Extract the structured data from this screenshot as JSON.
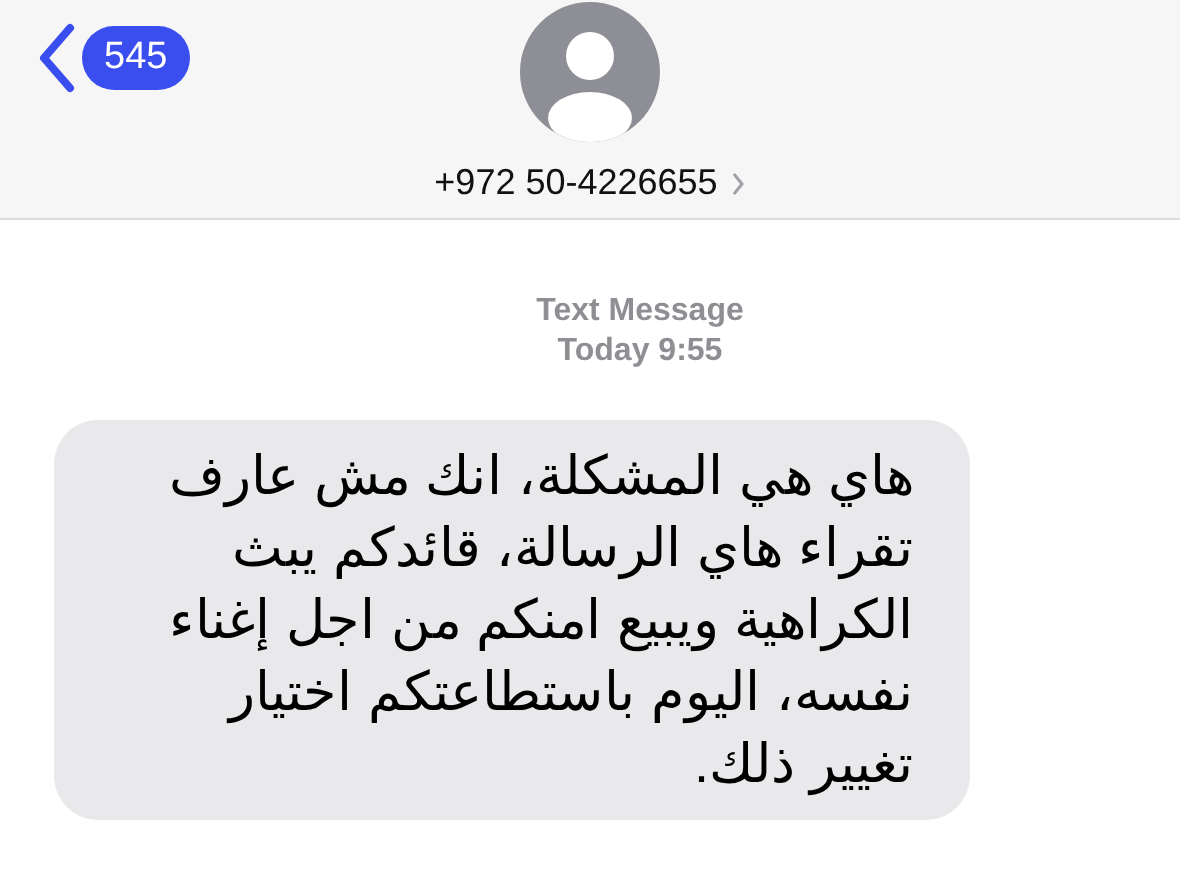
{
  "header": {
    "back_count": "545",
    "contact": "+972 50-4226655"
  },
  "conversation": {
    "service": "Text Message",
    "timestamp": "Today 9:55",
    "messages": [
      {
        "text": "هاي هي المشكلة، انك مش عارف تقراء هاي الرسالة، قائدكم يبث الكراهية ويبيع امنكم من اجل إغناء نفسه، اليوم باستطاعتكم اختيار تغيير ذلك."
      }
    ]
  }
}
